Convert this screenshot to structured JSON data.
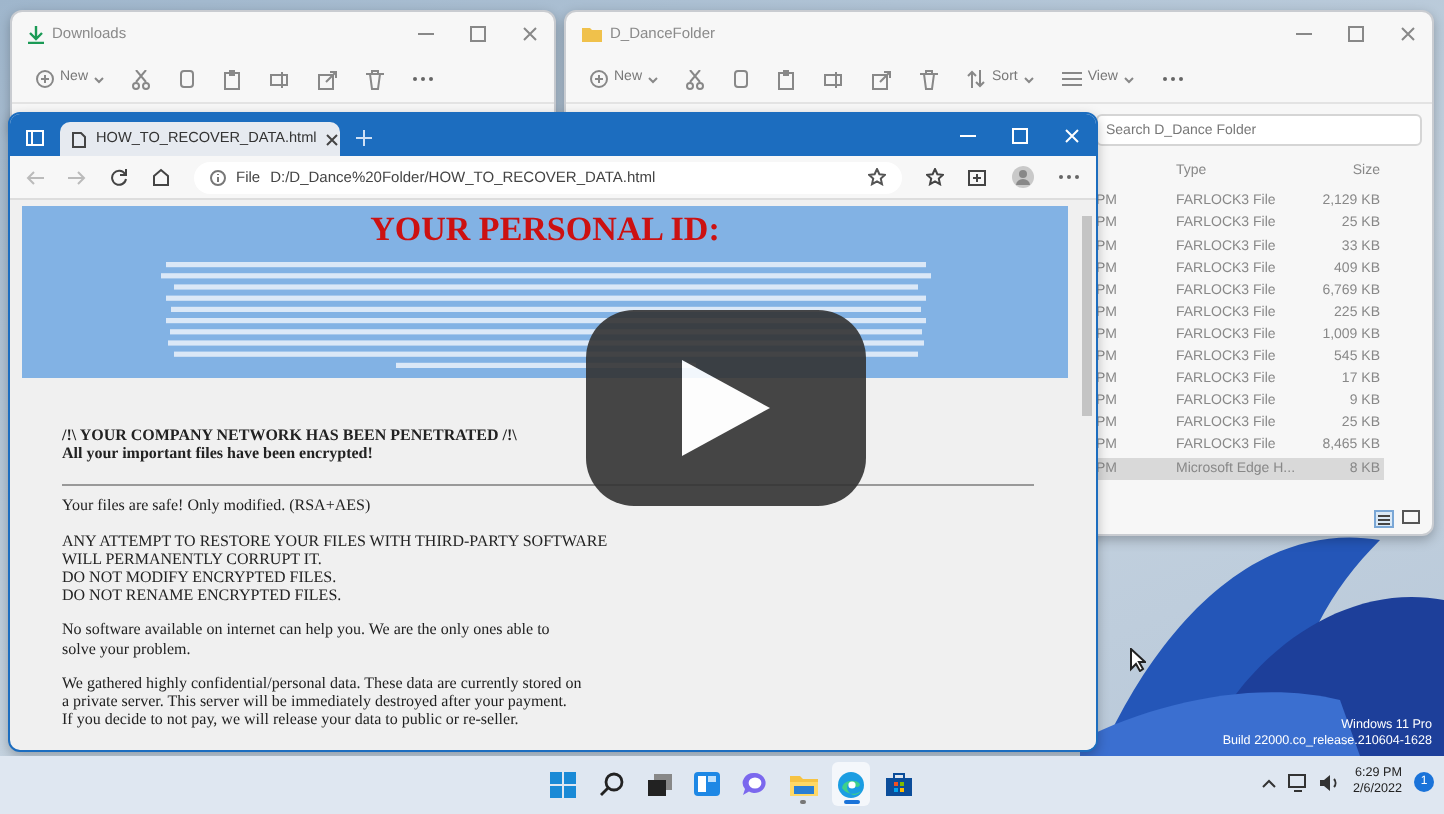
{
  "downloads_window": {
    "title": "Downloads",
    "new_label": "New"
  },
  "folder_window": {
    "title": "D_DanceFolder",
    "new_label": "New",
    "sort_label": "Sort",
    "view_label": "View",
    "search": {
      "placeholder": "Search D_Dance Folder"
    },
    "columns": [
      "Type",
      "Size"
    ],
    "rows": [
      {
        "date": "PM",
        "type": "FARLOCK3 File",
        "size": "2,129 KB",
        "selected": false
      },
      {
        "date": "PM",
        "type": "FARLOCK3 File",
        "size": "25 KB",
        "selected": false
      },
      {
        "date": "PM",
        "type": "FARLOCK3 File",
        "size": "33 KB",
        "selected": false
      },
      {
        "date": "PM",
        "type": "FARLOCK3 File",
        "size": "409 KB",
        "selected": false
      },
      {
        "date": "PM",
        "type": "FARLOCK3 File",
        "size": "6,769 KB",
        "selected": false
      },
      {
        "date": "PM",
        "type": "FARLOCK3 File",
        "size": "225 KB",
        "selected": false
      },
      {
        "date": "PM",
        "type": "FARLOCK3 File",
        "size": "1,009 KB",
        "selected": false
      },
      {
        "date": "PM",
        "type": "FARLOCK3 File",
        "size": "545 KB",
        "selected": false
      },
      {
        "date": "PM",
        "type": "FARLOCK3 File",
        "size": "17 KB",
        "selected": false
      },
      {
        "date": "PM",
        "type": "FARLOCK3 File",
        "size": "9 KB",
        "selected": false
      },
      {
        "date": "PM",
        "type": "FARLOCK3 File",
        "size": "25 KB",
        "selected": false
      },
      {
        "date": "PM",
        "type": "FARLOCK3 File",
        "size": "8,465 KB",
        "selected": false
      },
      {
        "date": "PM",
        "type": "Microsoft Edge H...",
        "size": "8 KB",
        "selected": true
      }
    ]
  },
  "browser": {
    "tab_title": "HOW_TO_RECOVER_DATA.html",
    "address_label": "File",
    "url": "D:/D_Dance%20Folder/HOW_TO_RECOVER_DATA.html",
    "page": {
      "heading": "YOUR PERSONAL ID:",
      "warning": [
        "/!\\ YOUR COMPANY NETWORK HAS BEEN PENETRATED /!\\",
        "All your important files have been encrypted!"
      ],
      "paragraphs": [
        [
          "Your files are safe! Only modified. (RSA+AES)"
        ],
        [
          "ANY ATTEMPT TO RESTORE YOUR FILES WITH THIRD-PARTY SOFTWARE",
          "WILL PERMANENTLY CORRUPT IT.",
          "DO NOT MODIFY ENCRYPTED FILES.",
          "DO NOT RENAME ENCRYPTED FILES."
        ],
        [
          "No software available on internet can help you. We are the only ones able to",
          "solve your problem."
        ],
        [
          "We gathered highly confidential/personal data. These data are currently stored on",
          "a private server. This server will be immediately destroyed after your payment.",
          "If you decide to not pay, we will release your data to public or re-seller."
        ]
      ]
    }
  },
  "video_overlay": {
    "play_button": true
  },
  "desktop": {
    "edition_text": [
      "Windows 11 Pro",
      "Build 22000.co_release.210604-1628"
    ]
  },
  "taskbar": {
    "apps": [
      {
        "kind": "start",
        "running": false,
        "active": false
      },
      {
        "kind": "search",
        "running": false,
        "active": false
      },
      {
        "kind": "task_view",
        "running": false,
        "active": false
      },
      {
        "kind": "widgets",
        "running": false,
        "active": false
      },
      {
        "kind": "chat",
        "running": false,
        "active": false
      },
      {
        "kind": "explorer",
        "running": true,
        "active": false
      },
      {
        "kind": "edge",
        "running": true,
        "active": true
      },
      {
        "kind": "store",
        "running": false,
        "active": false
      }
    ],
    "time": "6:29 PM",
    "date": "2/6/2022",
    "notification_count": "1"
  }
}
